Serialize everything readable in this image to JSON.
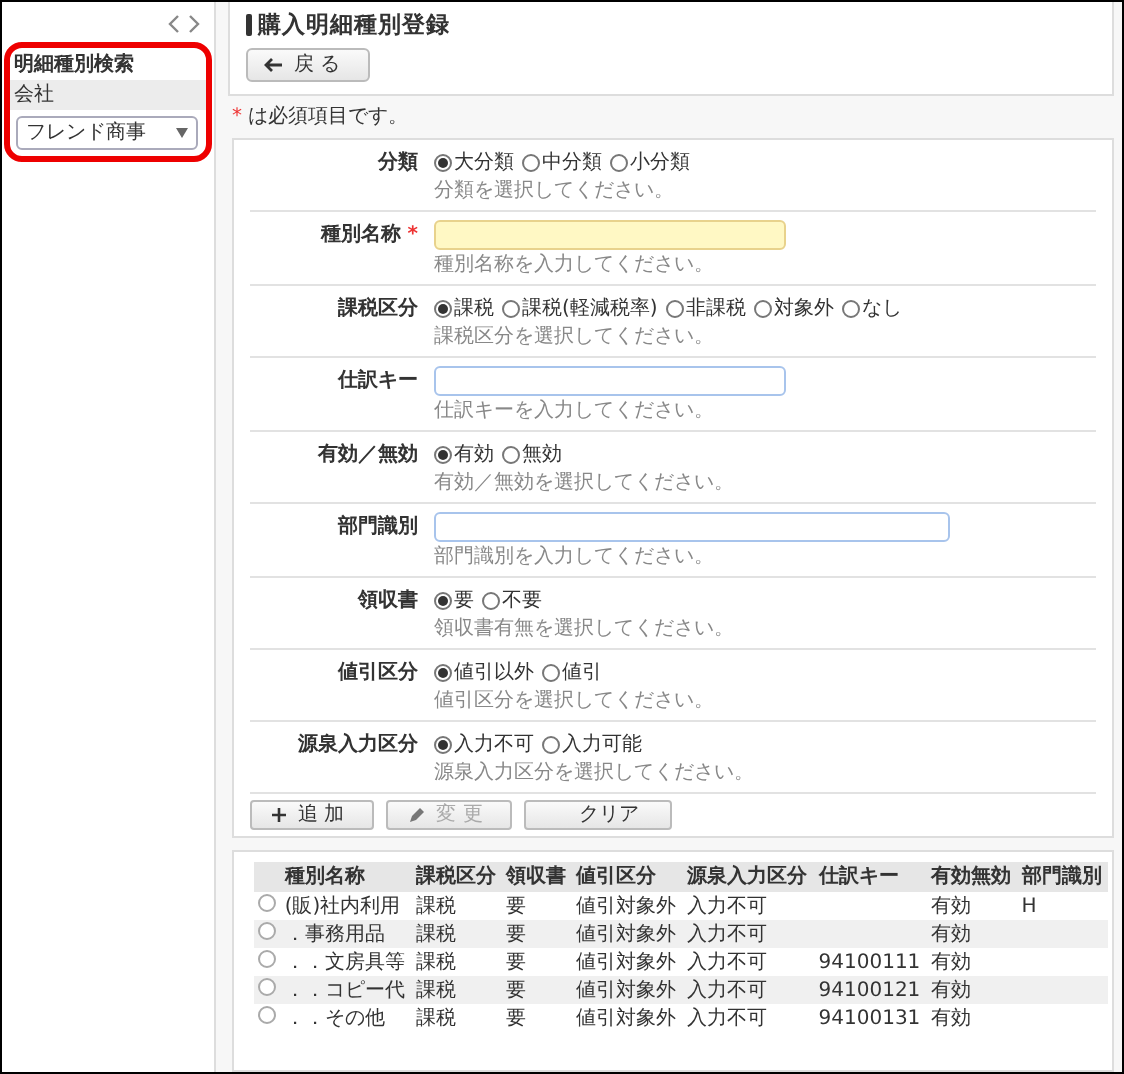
{
  "sidebar": {
    "title": "明細種別検索",
    "company_label": "会社",
    "company_select": {
      "value": "フレンド商事"
    }
  },
  "header": {
    "title": "購入明細種別登録",
    "back_button": "戻 る"
  },
  "required_note": {
    "mark": "*",
    "text": "は必須項目です。"
  },
  "form": {
    "fields": [
      {
        "kind": "radio",
        "label": "分類",
        "required": false,
        "options": [
          {
            "label": "大分類",
            "selected": true
          },
          {
            "label": "中分類",
            "selected": false
          },
          {
            "label": "小分類",
            "selected": false
          }
        ],
        "hint": "分類を選択してください。"
      },
      {
        "kind": "text",
        "label": "種別名称",
        "required": true,
        "hint": "種別名称を入力してください。"
      },
      {
        "kind": "radio",
        "label": "課税区分",
        "required": false,
        "options": [
          {
            "label": "課税",
            "selected": true
          },
          {
            "label": "課税(軽減税率)",
            "selected": false
          },
          {
            "label": "非課税",
            "selected": false
          },
          {
            "label": "対象外",
            "selected": false
          },
          {
            "label": "なし",
            "selected": false
          }
        ],
        "hint": "課税区分を選択してください。"
      },
      {
        "kind": "text",
        "label": "仕訳キー",
        "required": false,
        "hint": "仕訳キーを入力してください。"
      },
      {
        "kind": "radio",
        "label": "有効／無効",
        "required": false,
        "options": [
          {
            "label": "有効",
            "selected": true
          },
          {
            "label": "無効",
            "selected": false
          }
        ],
        "hint": "有効／無効を選択してください。"
      },
      {
        "kind": "text",
        "label": "部門識別",
        "required": false,
        "hint": "部門識別を入力してください。"
      },
      {
        "kind": "radio",
        "label": "領収書",
        "required": false,
        "options": [
          {
            "label": "要",
            "selected": true
          },
          {
            "label": "不要",
            "selected": false
          }
        ],
        "hint": "領収書有無を選択してください。"
      },
      {
        "kind": "radio",
        "label": "値引区分",
        "required": false,
        "options": [
          {
            "label": "値引以外",
            "selected": true
          },
          {
            "label": "値引",
            "selected": false
          }
        ],
        "hint": "値引区分を選択してください。"
      },
      {
        "kind": "radio",
        "label": "源泉入力区分",
        "required": false,
        "options": [
          {
            "label": "入力不可",
            "selected": true
          },
          {
            "label": "入力可能",
            "selected": false
          }
        ],
        "hint": "源泉入力区分を選択してください。"
      }
    ],
    "buttons": [
      {
        "label": "追 加",
        "disabled": false
      },
      {
        "label": "変 更",
        "disabled": true
      },
      {
        "label": "クリア",
        "disabled": false
      }
    ]
  },
  "table": {
    "columns": [
      "種別名称",
      "課税区分",
      "領収書",
      "値引区分",
      "源泉入力区分",
      "仕訳キー",
      "有効無効",
      "部門識別"
    ],
    "rows": [
      {
        "selected": false,
        "cells": [
          "(販)社内利用",
          "課税",
          "要",
          "値引対象外",
          "入力不可",
          "",
          "有効",
          "H"
        ]
      },
      {
        "selected": false,
        "cells": [
          "．事務用品",
          "課税",
          "要",
          "値引対象外",
          "入力不可",
          "",
          "有効",
          ""
        ]
      },
      {
        "selected": false,
        "cells": [
          "．．文房具等",
          "課税",
          "要",
          "値引対象外",
          "入力不可",
          "94100111",
          "有効",
          ""
        ]
      },
      {
        "selected": false,
        "cells": [
          "．．コピー代",
          "課税",
          "要",
          "値引対象外",
          "入力不可",
          "94100121",
          "有効",
          ""
        ]
      },
      {
        "selected": false,
        "cells": [
          "．．その他",
          "課税",
          "要",
          "値引対象外",
          "入力不可",
          "94100131",
          "有効",
          ""
        ]
      }
    ]
  }
}
